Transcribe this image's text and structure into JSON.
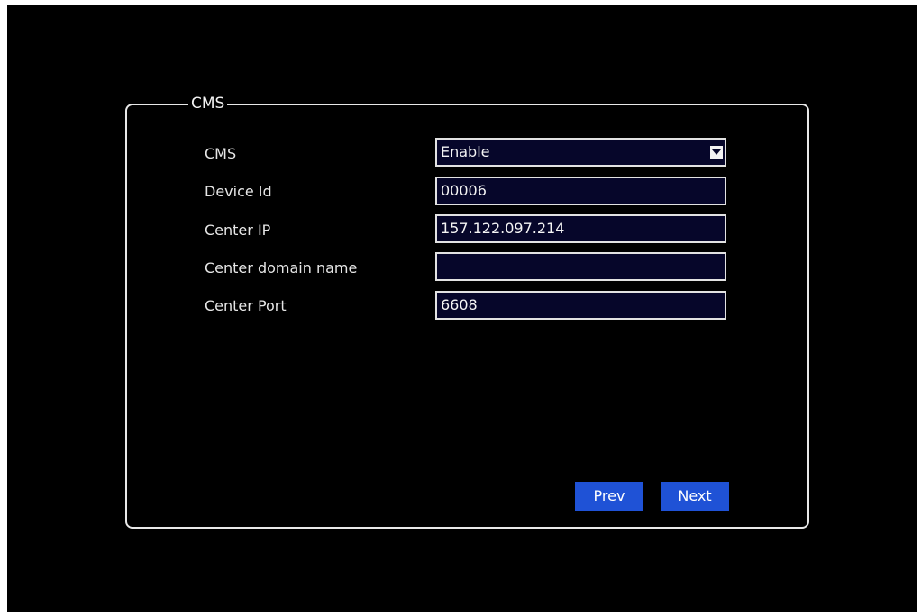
{
  "panel": {
    "title": "CMS"
  },
  "fields": [
    {
      "label": "CMS",
      "value": "Enable"
    },
    {
      "label": "Device Id",
      "value": "00006"
    },
    {
      "label": "Center IP",
      "value": "157.122.097.214"
    },
    {
      "label": "Center domain name",
      "value": ""
    },
    {
      "label": "Center Port",
      "value": "6608"
    }
  ],
  "buttons": {
    "prev_label": "Prev",
    "next_label": "Next"
  },
  "colors": {
    "background": "#000000",
    "field_background": "#06062a",
    "button": "#1f52d6",
    "border": "#e8e8e8"
  }
}
